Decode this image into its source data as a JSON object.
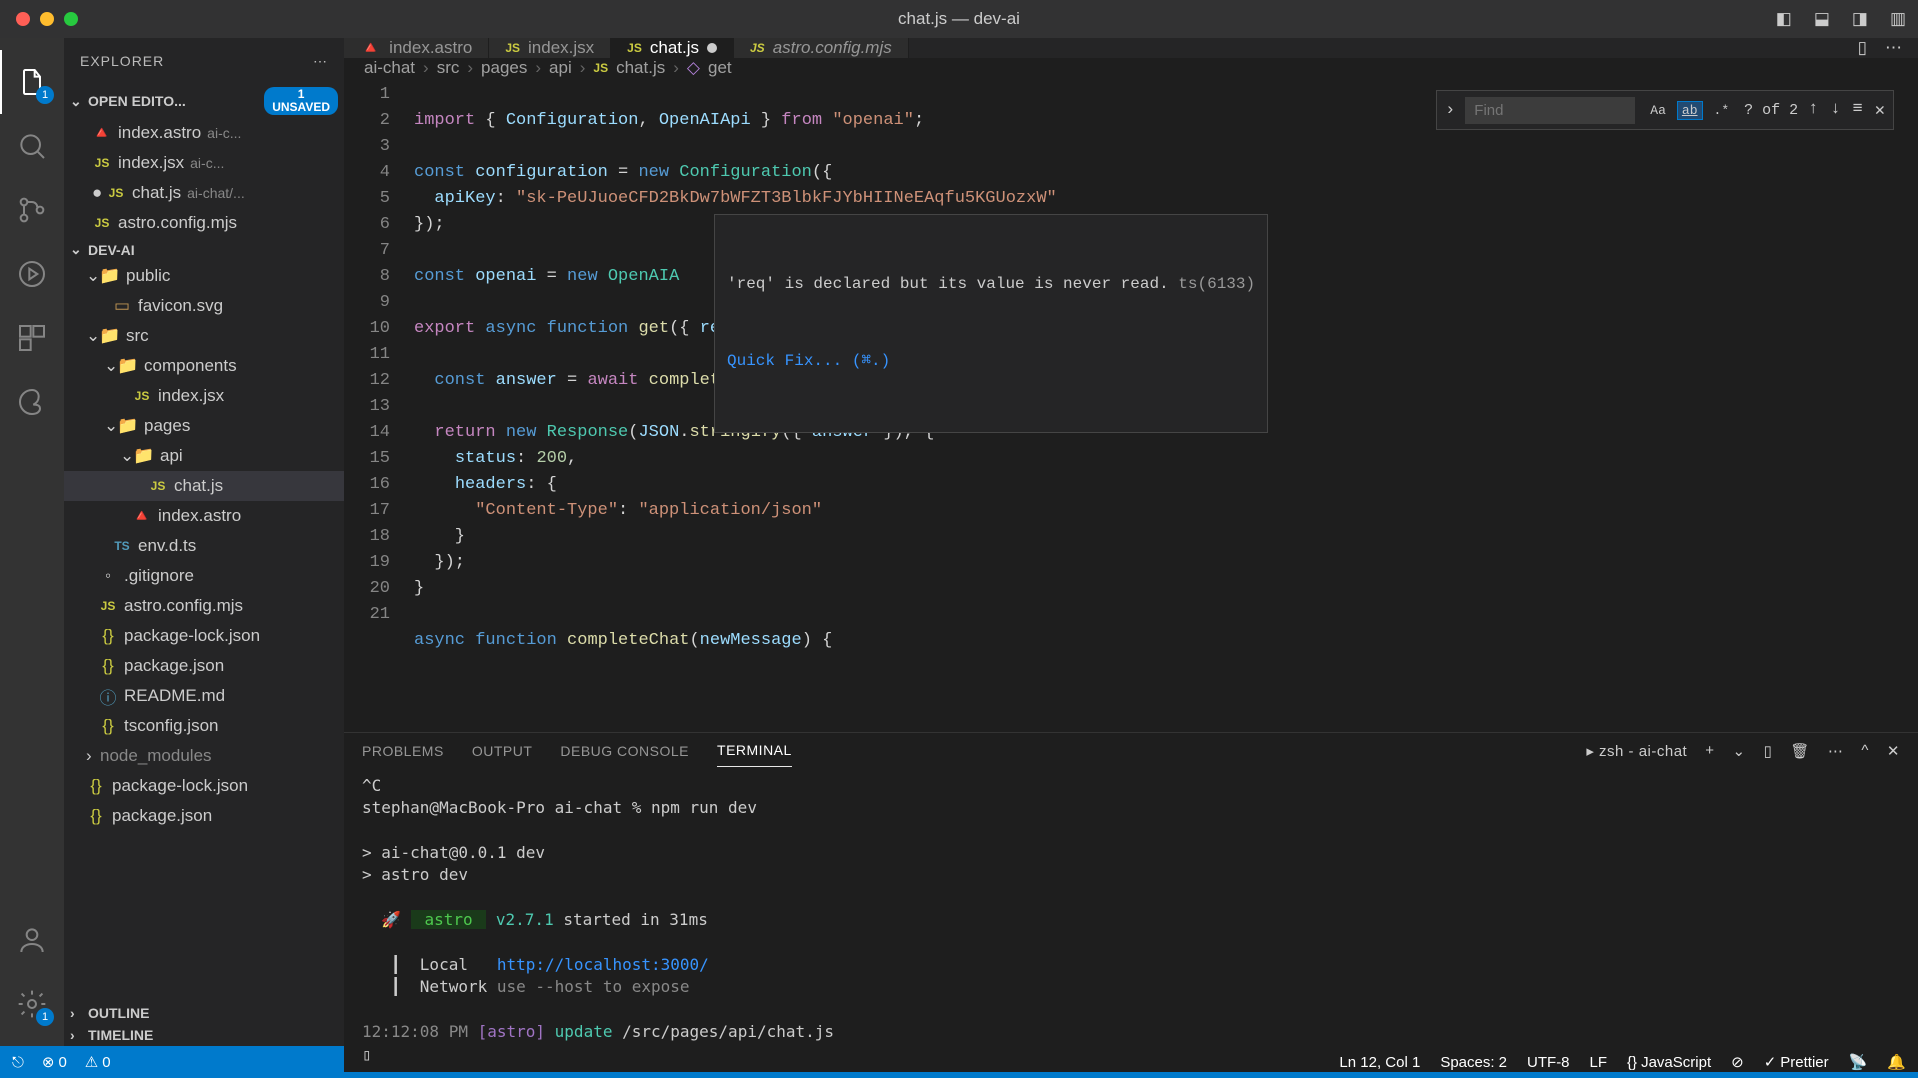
{
  "window": {
    "title": "chat.js — dev-ai"
  },
  "activity": {
    "badge_files": "1",
    "badge_settings": "1"
  },
  "sidebar": {
    "title": "EXPLORER",
    "sections": {
      "open_editors": {
        "label": "OPEN EDITO...",
        "unsaved_count": "1",
        "unsaved_label": "unsaved"
      },
      "project": {
        "label": "DEV-AI"
      },
      "outline": {
        "label": "OUTLINE"
      },
      "timeline": {
        "label": "TIMELINE"
      }
    },
    "open_editors": [
      {
        "name": "index.astro",
        "hint": "ai-c..."
      },
      {
        "name": "index.jsx",
        "hint": "ai-c..."
      },
      {
        "name": "chat.js",
        "hint": "ai-chat/..."
      },
      {
        "name": "astro.config.mjs",
        "hint": "..."
      }
    ],
    "tree": {
      "public": "public",
      "favicon": "favicon.svg",
      "src": "src",
      "components": "components",
      "index_jsx": "index.jsx",
      "pages": "pages",
      "api": "api",
      "chat_js": "chat.js",
      "index_astro": "index.astro",
      "env": "env.d.ts",
      "gitignore": ".gitignore",
      "astro_config": "astro.config.mjs",
      "pkg_lock": "package-lock.json",
      "pkg": "package.json",
      "readme": "README.md",
      "tsconfig": "tsconfig.json",
      "node_modules": "node_modules",
      "pkg_lock2": "package-lock.json",
      "pkg2": "package.json"
    }
  },
  "tabs": [
    {
      "name": "index.astro"
    },
    {
      "name": "index.jsx"
    },
    {
      "name": "chat.js",
      "active": true,
      "modified": true
    },
    {
      "name": "astro.config.mjs"
    }
  ],
  "breadcrumbs": [
    "ai-chat",
    "src",
    "pages",
    "api",
    "chat.js",
    "get"
  ],
  "find": {
    "placeholder": "Find",
    "matches": "? of 2"
  },
  "hover": {
    "message": "'req' is declared but its value is never read.",
    "code": "ts(6133)",
    "quickfix": "Quick Fix... (⌘.)"
  },
  "code": {
    "lines": [
      "import { Configuration, OpenAIApi } from \"openai\";",
      "",
      "const configuration = new Configuration({",
      "  apiKey: \"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\"",
      "});",
      "",
      "const openai = new OpenAIA",
      "",
      "export async function get({ request: req }) {",
      "",
      "  const answer = await completeChat();",
      "",
      "  return new Response(JSON.stringify({ answer }), {",
      "    status: 200,",
      "    headers: {",
      "      \"Content-Type\": \"application/json\"",
      "    }",
      "  });",
      "}",
      "",
      "async function completeChat(newMessage) {"
    ]
  },
  "panel": {
    "tabs": [
      "PROBLEMS",
      "OUTPUT",
      "DEBUG CONSOLE",
      "TERMINAL"
    ],
    "shell": "zsh - ai-chat",
    "terminal": {
      "l1": "^C",
      "l2": "stephan@MacBook-Pro ai-chat % npm run dev",
      "l3": "",
      "l4": "> ai-chat@0.0.1 dev",
      "l5": "> astro dev",
      "l6": "",
      "l7_rocket": "🚀",
      "l7_astro": " astro ",
      "l7_ver": " v2.7.1",
      "l7_rest": " started in 31ms",
      "l8_local": "  Local   ",
      "l8_url": "http://localhost:3000/",
      "l9_net": "  Network ",
      "l9_hint": "use --host to expose",
      "l10_time": "12:12:08 PM ",
      "l10_label": "[astro]",
      "l10_update": " update ",
      "l10_path": "/src/pages/api/chat.js"
    }
  },
  "status": {
    "errors": "0",
    "warnings": "0",
    "ln_col": "Ln 12, Col 1",
    "spaces": "Spaces: 2",
    "encoding": "UTF-8",
    "eol": "LF",
    "lang": "JavaScript",
    "prettier": "Prettier"
  }
}
